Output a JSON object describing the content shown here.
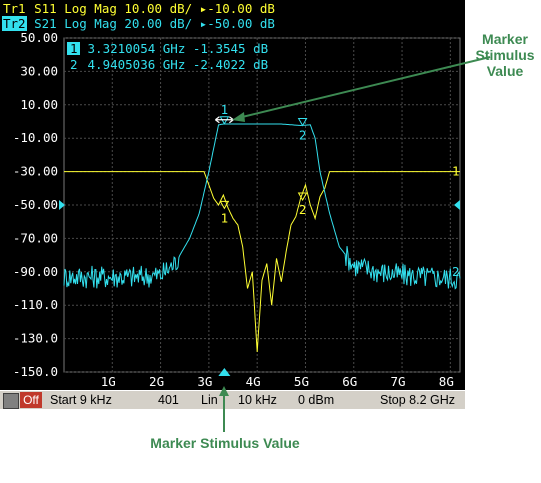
{
  "header": {
    "trace1": {
      "tag": "Tr1",
      "rest": " S11 Log Mag 10.00 dB/ ▸-10.00 dB"
    },
    "trace2": {
      "tag": "Tr2",
      "rest": " S21 Log Mag 20.00 dB/ ▸-50.00 dB"
    }
  },
  "marker_table": {
    "row1": {
      "num": "1",
      "text": " 3.3210054 GHz -1.3545 dB"
    },
    "row2": {
      "num": "2",
      "text": " 4.9405036 GHz -2.4022 dB"
    }
  },
  "status_bar": {
    "off_label": "Off",
    "start": "Start 9 kHz",
    "points": "401",
    "sweep_type": "Lin",
    "ifbw": "10 kHz",
    "power": "0 dBm",
    "stop": "Stop 8.2 GHz"
  },
  "callouts": {
    "right": "Marker Stimulus Value",
    "bottom": "Marker Stimulus Value"
  },
  "colors": {
    "trace1": "#ffff33",
    "trace2": "#33e0ee",
    "grid": "#4a4a4a",
    "background": "#000000",
    "callout": "#3d8a52"
  },
  "chart_data": {
    "type": "line",
    "xlabel": "",
    "ylabel": "",
    "x_unit": "GHz",
    "xlim": [
      0,
      8.2
    ],
    "ylim": [
      -150,
      50
    ],
    "x_ticks": [
      1,
      2,
      3,
      4,
      5,
      6,
      7,
      8
    ],
    "x_tick_labels": [
      "1G",
      "2G",
      "3G",
      "4G",
      "5G",
      "6G",
      "7G",
      "8G"
    ],
    "y_ticks": [
      50,
      30,
      10,
      -10,
      -30,
      -50,
      -70,
      -90,
      -110,
      -130,
      -150
    ],
    "y_tick_labels": [
      "50.00",
      "30.00",
      "10.00",
      "-10.00",
      "-30.00",
      "-50.00",
      "-70.00",
      "-90.00",
      "-110.0",
      "-130.0",
      "-150.0"
    ],
    "grid": true,
    "series": [
      {
        "name": "Tr1 S11",
        "color": "#ffff33",
        "x": [
          0.0,
          2.5,
          2.9,
          3.0,
          3.1,
          3.2,
          3.3,
          3.4,
          3.5,
          3.6,
          3.7,
          3.8,
          3.9,
          4.0,
          4.1,
          4.2,
          4.3,
          4.4,
          4.5,
          4.6,
          4.7,
          4.8,
          4.9,
          5.0,
          5.1,
          5.2,
          5.3,
          5.4,
          5.5,
          6.0,
          8.2
        ],
        "values": [
          -30,
          -30,
          -30,
          -38,
          -46,
          -50,
          -44,
          -52,
          -58,
          -62,
          -75,
          -100,
          -90,
          -138,
          -95,
          -85,
          -110,
          -82,
          -96,
          -78,
          -62,
          -57,
          -46,
          -38,
          -50,
          -58,
          -45,
          -40,
          -30,
          -30,
          -30
        ]
      },
      {
        "name": "Tr2 S21",
        "color": "#33e0ee",
        "x": [
          0.0,
          1.5,
          2.0,
          2.3,
          2.6,
          2.8,
          3.0,
          3.2,
          3.3,
          3.6,
          4.0,
          4.5,
          4.9,
          5.1,
          5.2,
          5.3,
          5.5,
          5.7,
          6.0,
          6.5,
          7.0,
          7.5,
          8.2
        ],
        "values": [
          -93,
          -93,
          -92,
          -85,
          -70,
          -55,
          -30,
          -2,
          -1.5,
          -1.5,
          -1.5,
          -1.5,
          -2.4,
          -2,
          -10,
          -30,
          -55,
          -75,
          -86,
          -90,
          -92,
          -93,
          -94
        ]
      }
    ],
    "markers": [
      {
        "trace": "Tr2",
        "num": "1",
        "x": 3.3210054,
        "y": -1.3545
      },
      {
        "trace": "Tr2",
        "num": "2",
        "x": 4.9405036,
        "y": -2.4022
      },
      {
        "trace": "Tr1",
        "num": "1",
        "x": 3.3210054,
        "y": -52
      },
      {
        "trace": "Tr1",
        "num": "2",
        "x": 4.9405036,
        "y": -47
      }
    ],
    "reference_indicators": [
      {
        "trace": "Tr1",
        "value": -30,
        "side": "right",
        "label": "1"
      },
      {
        "trace": "Tr2",
        "value": -90,
        "side": "right",
        "label": "2"
      },
      {
        "trace": "Tr2",
        "value": -50,
        "side": "both",
        "label": ""
      }
    ]
  }
}
